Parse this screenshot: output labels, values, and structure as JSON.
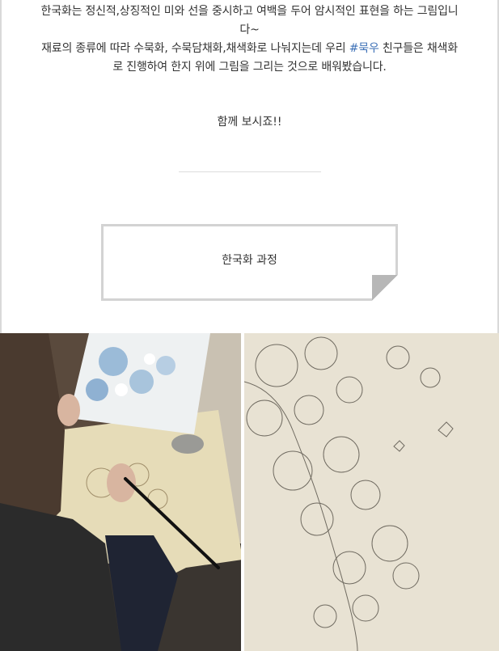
{
  "intro": {
    "line1": "한국화는 정신적,상징적인 미와 선을 중시하고 여백을 두어 암시적인 표현을 하는 그림입니",
    "line2": "다~",
    "line3_before": "재료의 종류에 따라 수묵화, 수묵담채화,채색화로 나눠지는데 우리 ",
    "line3_hashtag": "#묵우",
    "line3_after": " 친구들은 채색화",
    "line4": "로 진행하여 한지 위에 그림을 그리는 것으로 배워봤습니다."
  },
  "closing": "함께 보시죠!!",
  "note": {
    "title": "한국화 과정"
  },
  "colors": {
    "hashtag": "#3b6fb6",
    "card_border": "#d3d3d3",
    "divider": "#dcdcdc"
  }
}
